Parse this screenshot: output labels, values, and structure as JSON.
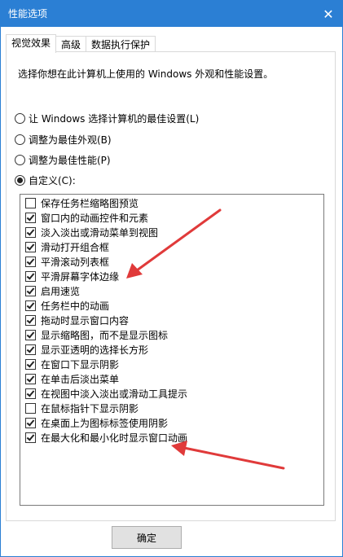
{
  "window": {
    "title": "性能选项",
    "close_symbol": "✕"
  },
  "tabs": [
    {
      "label": "视觉效果",
      "active": true
    },
    {
      "label": "高级",
      "active": false
    },
    {
      "label": "数据执行保护",
      "active": false
    }
  ],
  "description": "选择你想在此计算机上使用的 Windows 外观和性能设置。",
  "radios": [
    {
      "label": "让 Windows 选择计算机的最佳设置(L)",
      "checked": false
    },
    {
      "label": "调整为最佳外观(B)",
      "checked": false
    },
    {
      "label": "调整为最佳性能(P)",
      "checked": false
    },
    {
      "label": "自定义(C):",
      "checked": true
    }
  ],
  "effects": [
    {
      "label": "保存任务栏缩略图预览",
      "checked": false
    },
    {
      "label": "窗口内的动画控件和元素",
      "checked": true
    },
    {
      "label": "淡入淡出或滑动菜单到视图",
      "checked": true
    },
    {
      "label": "滑动打开组合框",
      "checked": true
    },
    {
      "label": "平滑滚动列表框",
      "checked": true
    },
    {
      "label": "平滑屏幕字体边缘",
      "checked": true
    },
    {
      "label": "启用速览",
      "checked": true
    },
    {
      "label": "任务栏中的动画",
      "checked": true
    },
    {
      "label": "拖动时显示窗口内容",
      "checked": true
    },
    {
      "label": "显示缩略图，而不是显示图标",
      "checked": true
    },
    {
      "label": "显示亚透明的选择长方形",
      "checked": true
    },
    {
      "label": "在窗口下显示阴影",
      "checked": true
    },
    {
      "label": "在单击后淡出菜单",
      "checked": true
    },
    {
      "label": "在视图中淡入淡出或滑动工具提示",
      "checked": true
    },
    {
      "label": "在鼠标指针下显示阴影",
      "checked": false
    },
    {
      "label": "在桌面上为图标标签使用阴影",
      "checked": true
    },
    {
      "label": "在最大化和最小化时显示窗口动画",
      "checked": true
    }
  ],
  "ok_button": "确定",
  "colors": {
    "titlebar": "#2b7fd4",
    "annotation_arrow": "#e03a3a"
  }
}
